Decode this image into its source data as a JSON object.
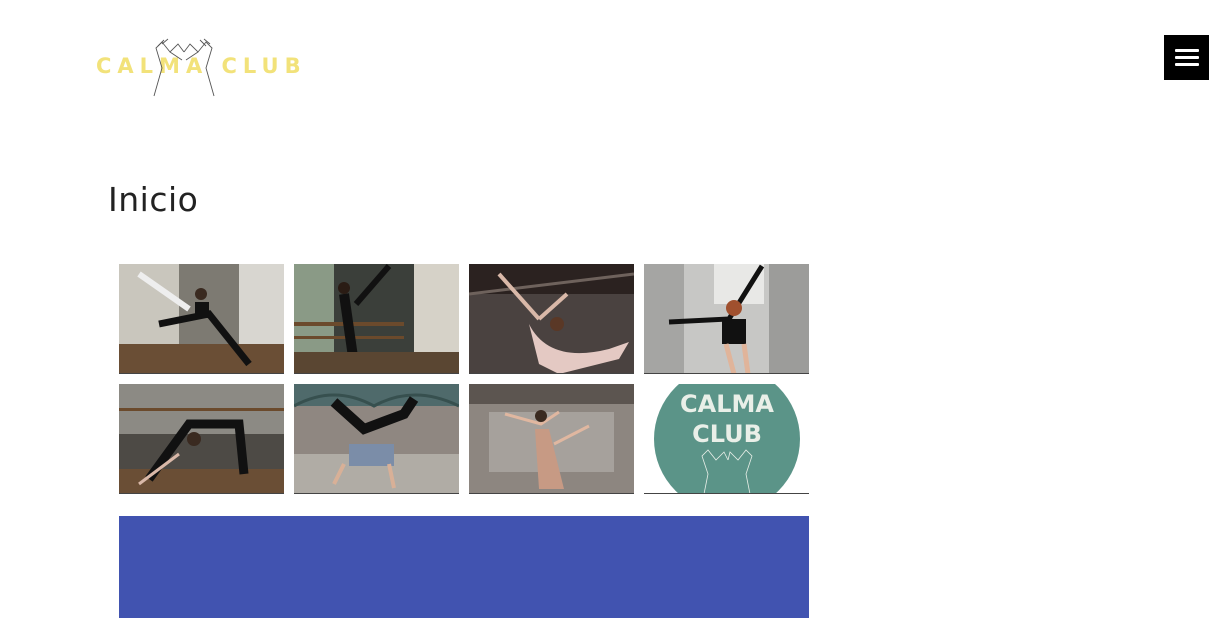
{
  "header": {
    "logo_text": "CALMA CLUB",
    "brand_color": "#f2e27a",
    "menu_icon": "hamburger-icon"
  },
  "main": {
    "title": "Inicio"
  },
  "gallery": {
    "items": [
      {
        "name": "photo-aerial-split",
        "alt": "dancer split on floor"
      },
      {
        "name": "photo-barre-kick",
        "alt": "dancer high kick at barre"
      },
      {
        "name": "photo-dancer-leap",
        "alt": "dancer leaping in pink dress"
      },
      {
        "name": "photo-dancer-jump",
        "alt": "dancer jumping in corridor"
      },
      {
        "name": "photo-backbend",
        "alt": "dancer backbend in studio"
      },
      {
        "name": "photo-breakdance",
        "alt": "breakdancer freeze"
      },
      {
        "name": "photo-contemporary",
        "alt": "contemporary dancer in warehouse"
      },
      {
        "name": "photo-calma-logo",
        "alt": "Calma Club logo",
        "text_line1": "CALMA",
        "text_line2": "CLUB"
      }
    ]
  },
  "banner": {
    "color": "#4153b0"
  }
}
